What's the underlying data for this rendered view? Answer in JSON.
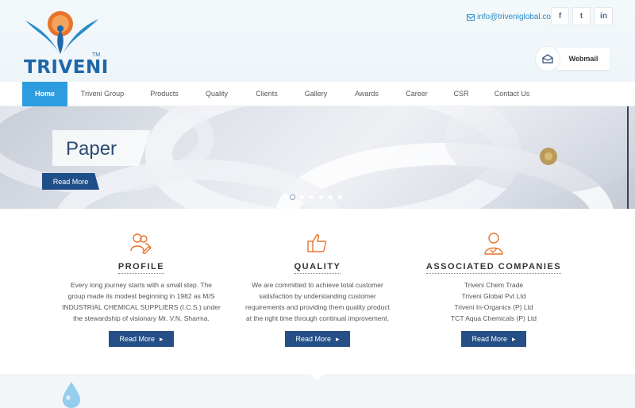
{
  "brand": {
    "name": "TRIVENI",
    "tm": "TM"
  },
  "header": {
    "email": "info@triveniglobal.com",
    "social": [
      "f",
      "t",
      "in"
    ],
    "webmail_label": "Webmail"
  },
  "nav": {
    "items": [
      {
        "label": "Home",
        "active": true
      },
      {
        "label": "Triveni Group"
      },
      {
        "label": "Products"
      },
      {
        "label": "Quality"
      },
      {
        "label": "Clients"
      },
      {
        "label": "Gallery"
      },
      {
        "label": "Awards"
      },
      {
        "label": "Career"
      },
      {
        "label": "CSR"
      },
      {
        "label": "Contact Us"
      }
    ]
  },
  "slider": {
    "title": "Paper",
    "button": "Read More",
    "dot_count": 6,
    "active_dot": 1
  },
  "features": [
    {
      "title": "PROFILE",
      "icon": "users-icon",
      "lines": [
        "Every long journey starts with a small step. The",
        "group made its modest beginning in 1982 as M/S",
        "INDUSTRIAL CHEMICAL SUPPLIERS (I.C.S.) under",
        "the stewardship of visionary Mr. V.N. Sharma."
      ],
      "button": "Read More"
    },
    {
      "title": "QUALITY",
      "icon": "thumbs-up-icon",
      "lines": [
        "We are committed to achieve total customer",
        "satisfaction by understanding customer",
        "requirements and providing them quality product",
        "at the right time through continual improvement."
      ],
      "button": "Read More"
    },
    {
      "title": "ASSOCIATED COMPANIES",
      "icon": "user-check-icon",
      "lines": [
        "Triveni Chem Trade",
        "Triveni Global Pvt Ltd",
        "Triveni In-Organics (P) Ltd",
        "TCT Aqua Chemicals (P) Ltd"
      ],
      "button": "Read More"
    }
  ],
  "colors": {
    "accent": "#2e9de0",
    "button": "#254f86",
    "icon": "#e8742c",
    "brand": "#1e67a8"
  }
}
